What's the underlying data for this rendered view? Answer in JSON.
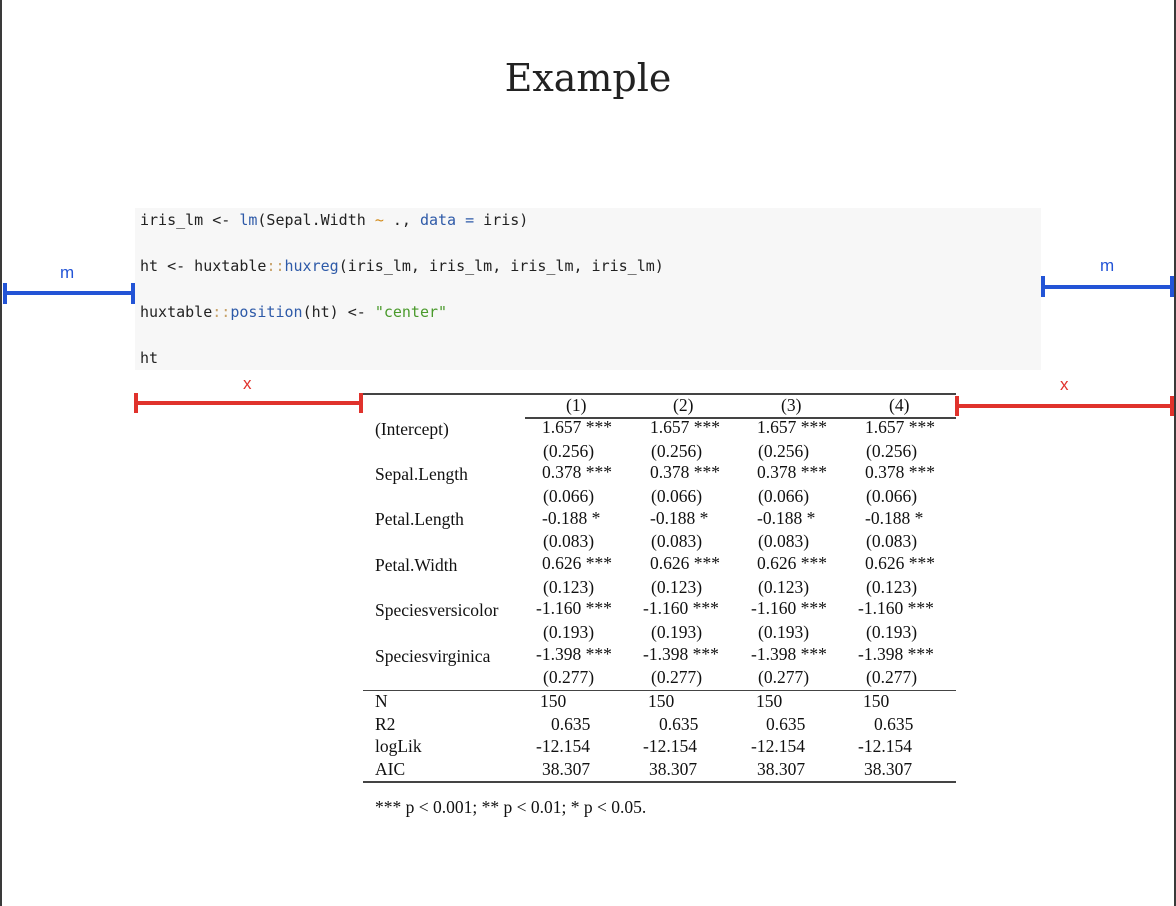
{
  "title": "Example",
  "code": {
    "line1": {
      "a": "iris_lm <- ",
      "b": "lm",
      "c": "(Sepal.Width ",
      "d": "~",
      "e": " ., ",
      "f": "data",
      "g": " ",
      "h": "=",
      "i": " iris)"
    },
    "line2": {
      "a": "ht <- huxtable",
      "b": "::",
      "c": "huxreg",
      "d": "(iris_lm, iris_lm, iris_lm, iris_lm)"
    },
    "line3": {
      "a": "huxtable",
      "b": "::",
      "c": "position",
      "d": "(ht) <- ",
      "e": "\"center\""
    },
    "line4": {
      "a": "ht"
    }
  },
  "margin_labels": {
    "m": "m",
    "x": "x"
  },
  "colors": {
    "blue": "#2354d6",
    "red": "#e0322c",
    "code_bg": "#f7f7f7"
  },
  "table": {
    "headers": [
      "(1)",
      "(2)",
      "(3)",
      "(4)"
    ],
    "rows": [
      {
        "term": "(Intercept)",
        "est": [
          "1.657 ***",
          "1.657 ***",
          "1.657 ***",
          "1.657 ***"
        ],
        "se": [
          "(0.256)",
          "(0.256)",
          "(0.256)",
          "(0.256)"
        ]
      },
      {
        "term": "Sepal.Length",
        "est": [
          "0.378 ***",
          "0.378 ***",
          "0.378 ***",
          "0.378 ***"
        ],
        "se": [
          "(0.066)",
          "(0.066)",
          "(0.066)",
          "(0.066)"
        ]
      },
      {
        "term": "Petal.Length",
        "est": [
          "-0.188 *",
          "-0.188 *",
          "-0.188 *",
          "-0.188 *"
        ],
        "se": [
          "(0.083)",
          "(0.083)",
          "(0.083)",
          "(0.083)"
        ]
      },
      {
        "term": "Petal.Width",
        "est": [
          "0.626 ***",
          "0.626 ***",
          "0.626 ***",
          "0.626 ***"
        ],
        "se": [
          "(0.123)",
          "(0.123)",
          "(0.123)",
          "(0.123)"
        ]
      },
      {
        "term": "Speciesversicolor",
        "est": [
          "-1.160 ***",
          "-1.160 ***",
          "-1.160 ***",
          "-1.160 ***"
        ],
        "se": [
          "(0.193)",
          "(0.193)",
          "(0.193)",
          "(0.193)"
        ]
      },
      {
        "term": "Speciesvirginica",
        "est": [
          "-1.398 ***",
          "-1.398 ***",
          "-1.398 ***",
          "-1.398 ***"
        ],
        "se": [
          "(0.277)",
          "(0.277)",
          "(0.277)",
          "(0.277)"
        ]
      }
    ],
    "stats": [
      {
        "name": "N",
        "vals": [
          "150",
          "150",
          "150",
          "150"
        ]
      },
      {
        "name": "R2",
        "vals": [
          "0.635",
          "0.635",
          "0.635",
          "0.635"
        ]
      },
      {
        "name": "logLik",
        "vals": [
          "-12.154",
          "-12.154",
          "-12.154",
          "-12.154"
        ]
      },
      {
        "name": "AIC",
        "vals": [
          "38.307",
          "38.307",
          "38.307",
          "38.307"
        ]
      }
    ]
  },
  "footnote": "*** p < 0.001; ** p < 0.01; * p < 0.05."
}
